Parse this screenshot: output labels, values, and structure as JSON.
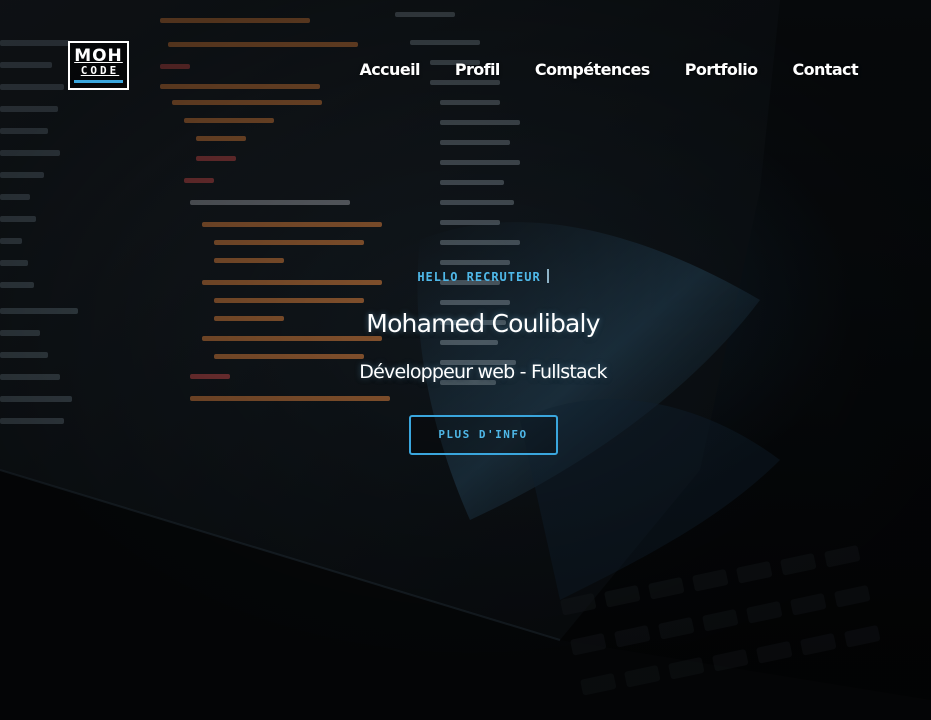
{
  "logo": {
    "top": "MOH",
    "bottom": "CODE"
  },
  "nav": {
    "items": [
      {
        "label": "Accueil"
      },
      {
        "label": "Profil"
      },
      {
        "label": "Compétences"
      },
      {
        "label": "Portfolio"
      },
      {
        "label": "Contact"
      }
    ]
  },
  "hero": {
    "eyebrow": "HELLO RECRUTEUR",
    "name": "Mohamed Coulibaly",
    "role": "Développeur web - Fullstack",
    "cta_label": "PLUS D'INFO"
  },
  "colors": {
    "accent": "#3aa6dd",
    "text": "#ffffff",
    "background": "#050709"
  },
  "icons": [
    "typing-cursor-icon"
  ]
}
